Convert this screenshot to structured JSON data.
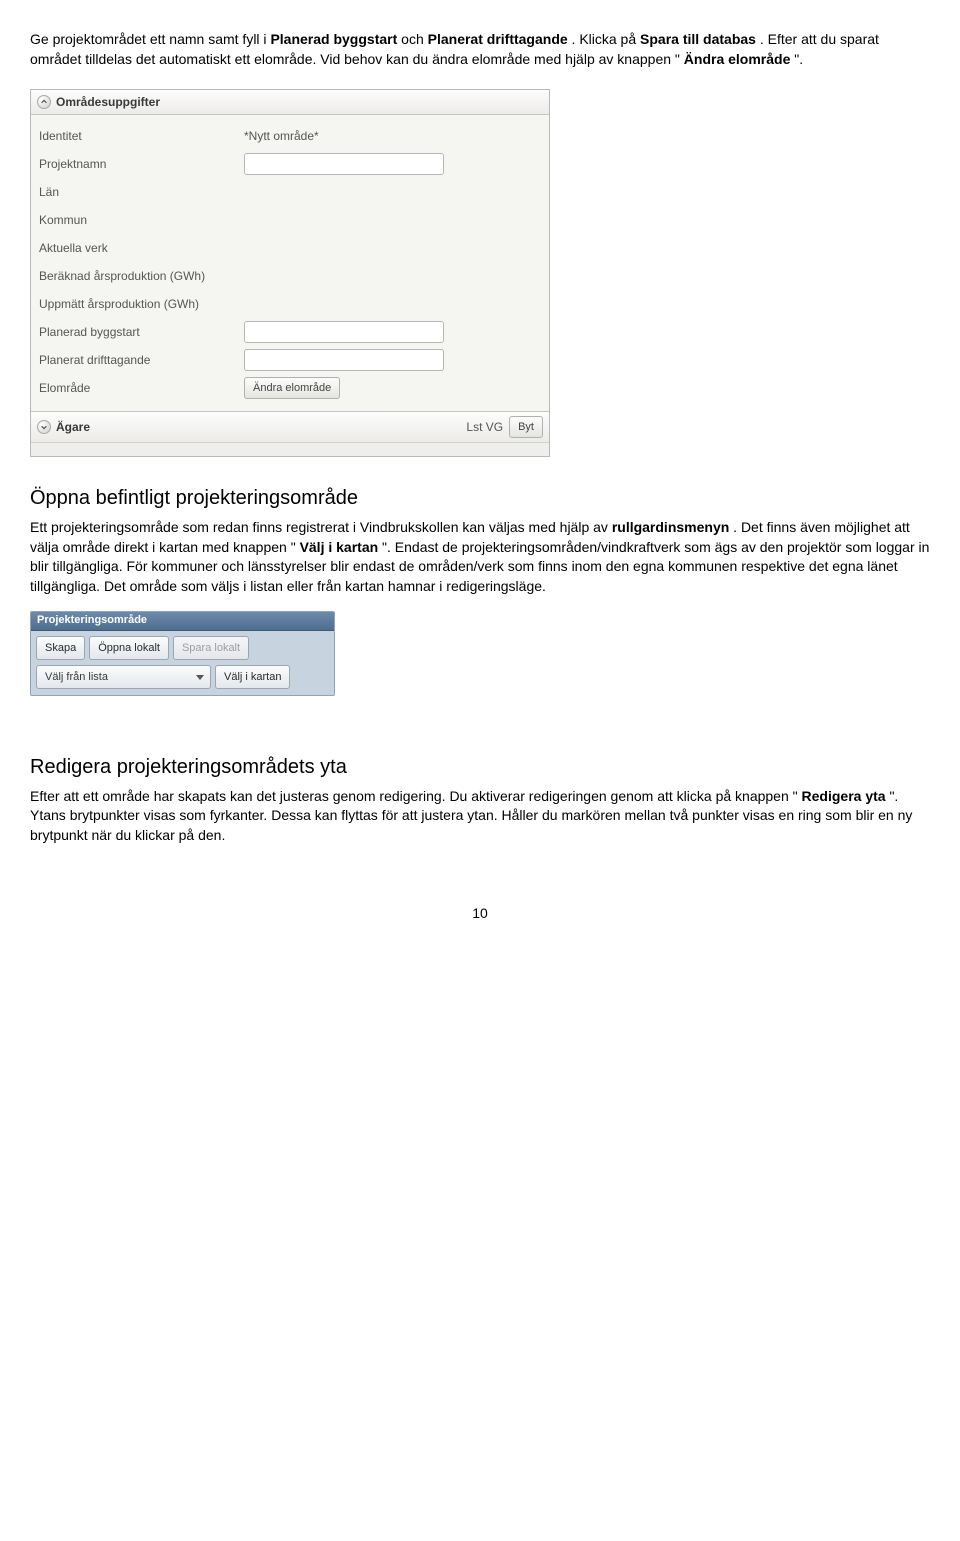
{
  "intro_paragraph": {
    "t1": "Ge projektområdet ett namn samt fyll i ",
    "b1": "Planerad byggstart",
    "t2": " och ",
    "b2": "Planerat drifttagande",
    "t3": ". Klicka på ",
    "b3": "Spara till databas",
    "t4": ". Efter att du sparat området tilldelas det automatiskt ett elområde. Vid behov kan du ändra elområde med hjälp av knappen \"",
    "b4": "Ändra elområde",
    "t5": "\"."
  },
  "panel1": {
    "header": "Områdesuppgifter",
    "rows": {
      "identitet_label": "Identitet",
      "identitet_value": "*Nytt område*",
      "projektnamn_label": "Projektnamn",
      "lan_label": "Län",
      "kommun_label": "Kommun",
      "aktuella_verk_label": "Aktuella verk",
      "beraknad_label": "Beräknad årsproduktion (GWh)",
      "uppmatt_label": "Uppmätt årsproduktion (GWh)",
      "plan_bygg_label": "Planerad byggstart",
      "plan_drift_label": "Planerat drifttagande",
      "elomrade_label": "Elområde",
      "elomrade_btn": "Ändra elområde"
    },
    "agare": {
      "label": "Ägare",
      "value": "Lst VG",
      "byt_btn": "Byt"
    }
  },
  "section2": {
    "heading": "Öppna befintligt projekteringsområde",
    "p_t1": "Ett projekteringsområde som redan finns registrerat i Vindbrukskollen kan väljas med hjälp av ",
    "p_b1": "rullgardinsmenyn",
    "p_t2": ". Det finns även möjlighet att välja område direkt i kartan med knappen \"",
    "p_b2": "Välj i kartan",
    "p_t3": "\". Endast de projekteringsområden/vindkraftverk som ägs av den projektör som loggar in blir tillgängliga. För kommuner och länsstyrelser blir endast de områden/verk som finns inom den egna kommunen respektive det egna länet tillgängliga. Det område som väljs i listan eller från kartan hamnar i redigeringsläge."
  },
  "panel2": {
    "header": "Projekteringsområde",
    "skapa": "Skapa",
    "oppna": "Öppna lokalt",
    "spara": "Spara lokalt",
    "valj_lista": "Välj från lista",
    "valj_kartan": "Välj i kartan"
  },
  "section3": {
    "heading": "Redigera projekteringsområdets yta",
    "p_t1": "Efter att ett område har skapats kan det justeras genom redigering. Du aktiverar redigeringen genom att klicka på knappen \"",
    "p_b1": "Redigera yta",
    "p_t2": "\". Ytans brytpunkter visas som fyrkanter. Dessa kan flyttas för att justera ytan. Håller du markören mellan två punkter visas en ring som blir en ny brytpunkt när du klickar på den."
  },
  "page_number": "10"
}
